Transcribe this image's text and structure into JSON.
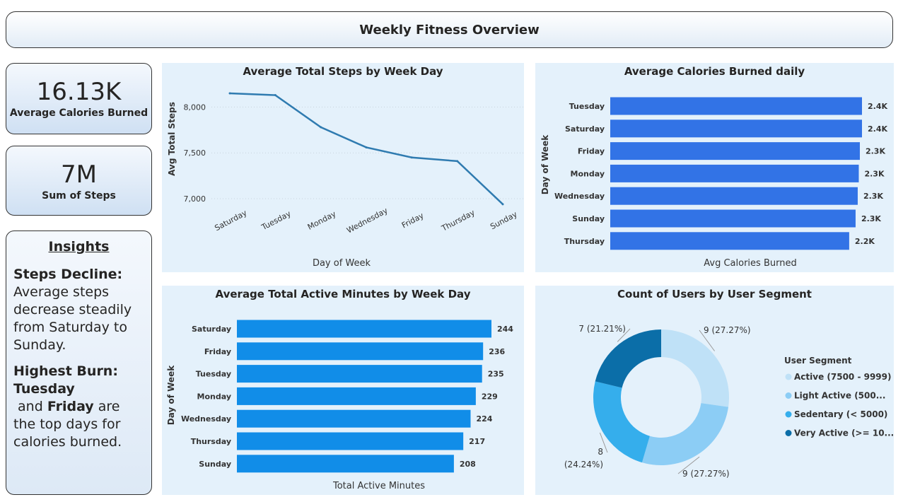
{
  "header": {
    "title": "Weekly Fitness Overview"
  },
  "kpis": {
    "calories": {
      "value": "16.13K",
      "label": "Average Calories Burned"
    },
    "steps": {
      "value": "7M",
      "label": "Sum of Steps"
    }
  },
  "insights": {
    "title": "Insights",
    "p1_bold": "Steps Decline:",
    "p1_text": "Average steps decrease steadily from Saturday to Sunday.",
    "p2_bold": "Highest Burn:",
    "p2_day1": "Tuesday",
    "p2_and": " and ",
    "p2_day2": "Friday",
    "p2_text": " are the top days for calories burned."
  },
  "chart_data": [
    {
      "type": "line",
      "title": "Average Total Steps by Week Day",
      "xlabel": "Day of Week",
      "ylabel": "Avg Total Steps",
      "categories": [
        "Saturday",
        "Tuesday",
        "Monday",
        "Wednesday",
        "Friday",
        "Thursday",
        "Sunday"
      ],
      "values": [
        8150,
        8130,
        7780,
        7560,
        7450,
        7410,
        6940
      ],
      "yticks": [
        7000,
        7500,
        8000
      ],
      "ytick_labels": [
        "7,000",
        "7,500",
        "8,000"
      ],
      "ylim": [
        6900,
        8250
      ],
      "color": "#2f7bb0"
    },
    {
      "type": "bar",
      "orientation": "horizontal",
      "title": "Average Calories Burned daily",
      "xlabel": "Avg Calories Burned",
      "ylabel": "Day of Week",
      "categories": [
        "Tuesday",
        "Saturday",
        "Friday",
        "Monday",
        "Wednesday",
        "Sunday",
        "Thursday"
      ],
      "values": [
        2.36,
        2.36,
        2.34,
        2.33,
        2.32,
        2.3,
        2.24
      ],
      "labels": [
        "2.4K",
        "2.4K",
        "2.3K",
        "2.3K",
        "2.3K",
        "2.3K",
        "2.2K"
      ],
      "xlim": [
        0,
        2.36
      ],
      "color": "#3273e6"
    },
    {
      "type": "bar",
      "orientation": "horizontal",
      "title": "Average Total Active Minutes by Week Day",
      "xlabel": "Total Active Minutes",
      "ylabel": "Day of Week",
      "categories": [
        "Saturday",
        "Friday",
        "Tuesday",
        "Monday",
        "Wednesday",
        "Thursday",
        "Sunday"
      ],
      "values": [
        244,
        236,
        235,
        229,
        224,
        217,
        208
      ],
      "labels": [
        "244",
        "236",
        "235",
        "229",
        "224",
        "217",
        "208"
      ],
      "xlim": [
        0,
        244
      ],
      "color": "#118de8"
    },
    {
      "type": "pie",
      "title": "Count of Users by User Segment",
      "legend_title": "User Segment",
      "legend_placement": "right",
      "series": [
        {
          "name": "Active (7500 - 9999)",
          "value": 9,
          "label": "9 (27.27%)",
          "color": "#bfe1f7"
        },
        {
          "name": "Light Active (500...",
          "value": 9,
          "label": "9 (27.27%)",
          "color": "#8ccdf5"
        },
        {
          "name": "Sedentary (< 5000)",
          "value": 8,
          "label": "8 (24.24%)",
          "color": "#35aeec"
        },
        {
          "name": "Very Active (>= 10...",
          "value": 7,
          "label": "7 (21.21%)",
          "color": "#0b6ea8"
        }
      ]
    }
  ]
}
